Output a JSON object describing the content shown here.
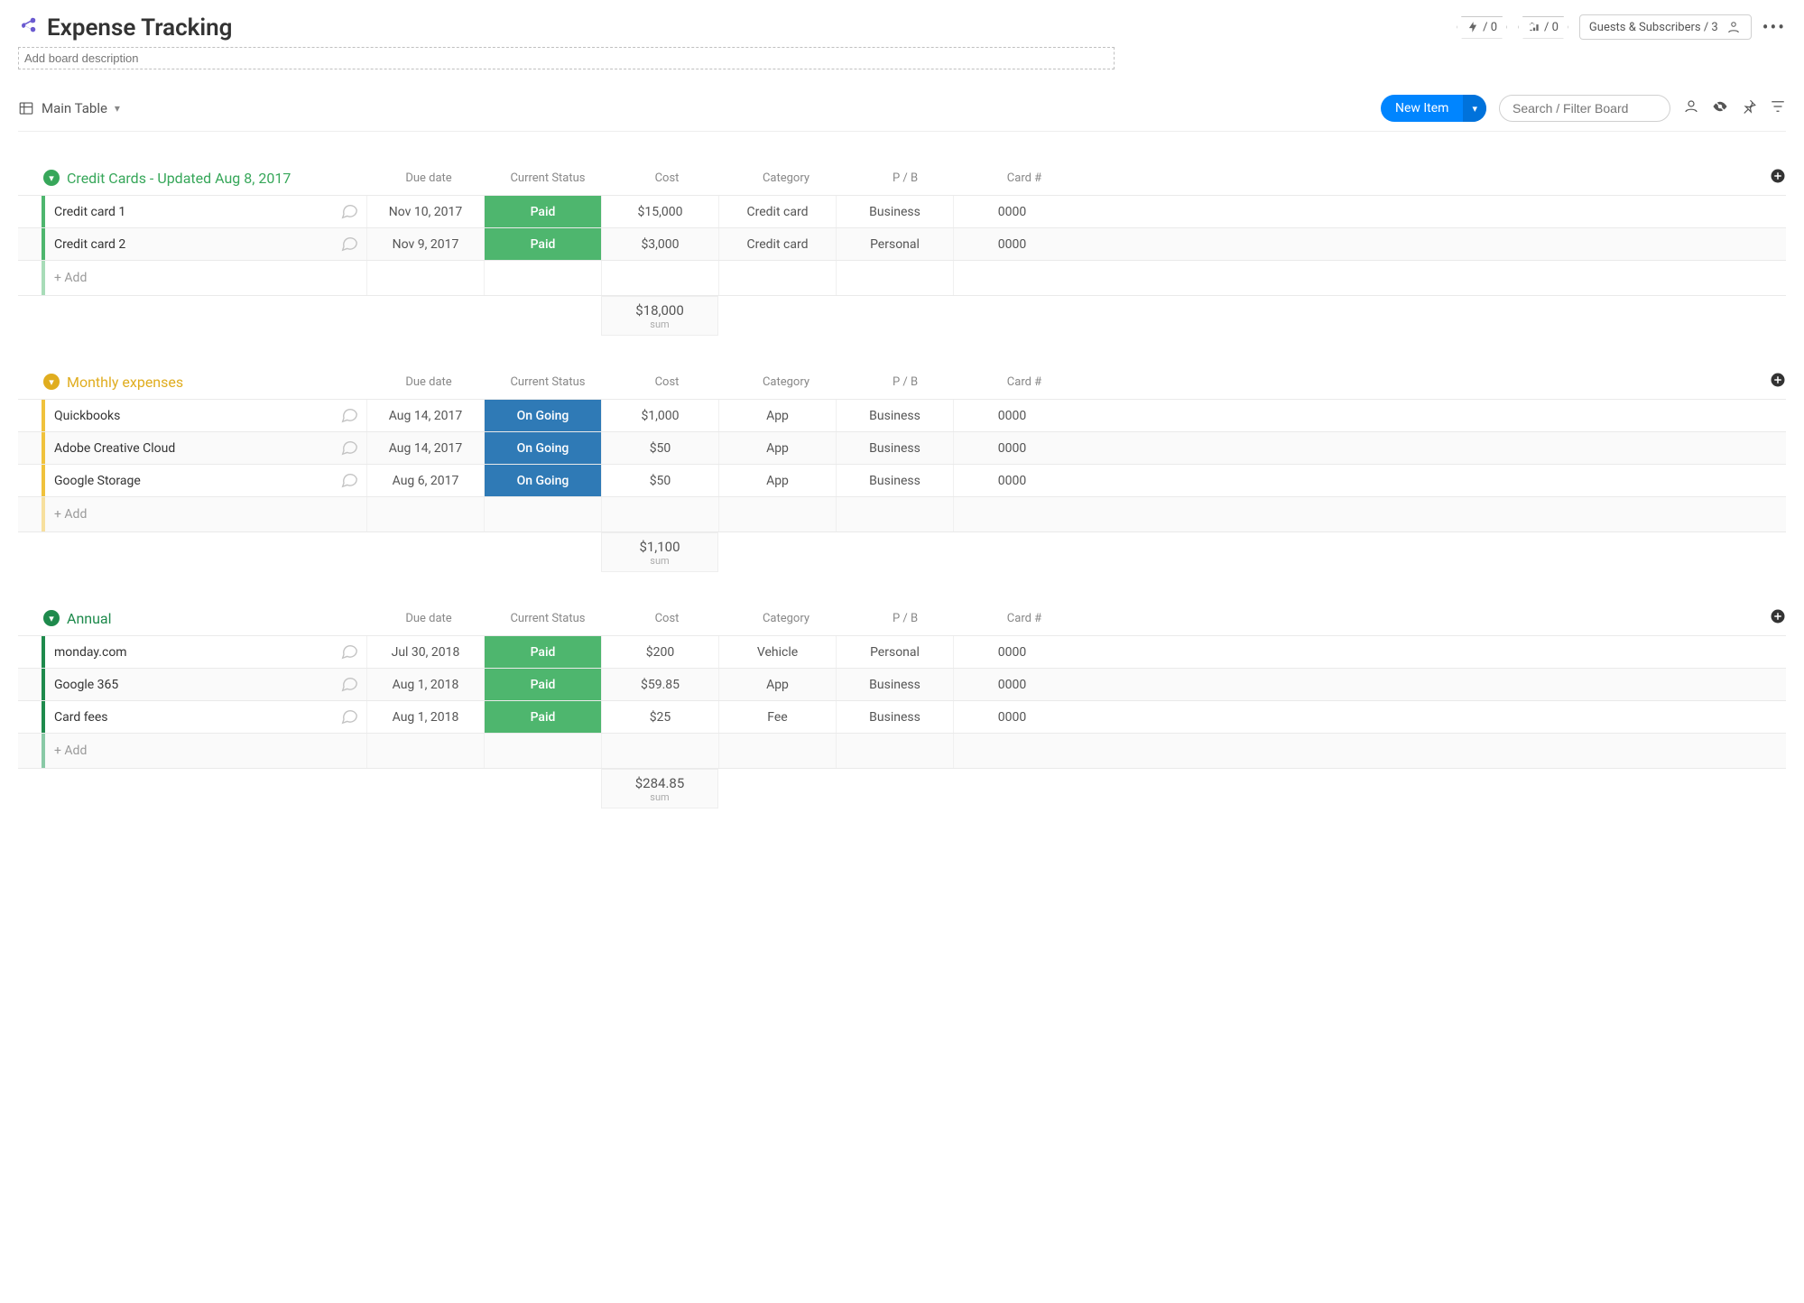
{
  "header": {
    "title": "Expense Tracking",
    "description_placeholder": "Add board description",
    "badge_integrations": "/ 0",
    "badge_automations": "/ 0",
    "guests_label": "Guests & Subscribers / 3"
  },
  "toolbar": {
    "view_label": "Main Table",
    "new_item_label": "New Item",
    "search_placeholder": "Search / Filter Board"
  },
  "columns": {
    "due_date": "Due date",
    "status": "Current Status",
    "cost": "Cost",
    "category": "Category",
    "pb": "P / B",
    "card": "Card #"
  },
  "add_row_label": "+ Add",
  "sum_label": "sum",
  "groups": [
    {
      "title": "Credit Cards - Updated Aug 8, 2017",
      "sum": "$18,000",
      "rows": [
        {
          "name": "Credit card 1",
          "due": "Nov 10, 2017",
          "status": "Paid",
          "status_class": "status-paid",
          "cost": "$15,000",
          "category": "Credit card",
          "pb": "Business",
          "card": "0000"
        },
        {
          "name": "Credit card 2",
          "due": "Nov 9, 2017",
          "status": "Paid",
          "status_class": "status-paid",
          "cost": "$3,000",
          "category": "Credit card",
          "pb": "Personal",
          "card": "0000"
        }
      ]
    },
    {
      "title": "Monthly expenses",
      "sum": "$1,100",
      "rows": [
        {
          "name": "Quickbooks",
          "due": "Aug 14, 2017",
          "status": "On Going",
          "status_class": "status-ongoing",
          "cost": "$1,000",
          "category": "App",
          "pb": "Business",
          "card": "0000"
        },
        {
          "name": "Adobe Creative Cloud",
          "due": "Aug 14, 2017",
          "status": "On Going",
          "status_class": "status-ongoing",
          "cost": "$50",
          "category": "App",
          "pb": "Business",
          "card": "0000"
        },
        {
          "name": "Google Storage",
          "due": "Aug 6, 2017",
          "status": "On Going",
          "status_class": "status-ongoing",
          "cost": "$50",
          "category": "App",
          "pb": "Business",
          "card": "0000"
        }
      ]
    },
    {
      "title": "Annual",
      "sum": "$284.85",
      "rows": [
        {
          "name": "monday.com",
          "due": "Jul 30, 2018",
          "status": "Paid",
          "status_class": "status-paid",
          "cost": "$200",
          "category": "Vehicle",
          "pb": "Personal",
          "card": "0000"
        },
        {
          "name": "Google 365",
          "due": "Aug 1, 2018",
          "status": "Paid",
          "status_class": "status-paid",
          "cost": "$59.85",
          "category": "App",
          "pb": "Business",
          "card": "0000"
        },
        {
          "name": "Card fees",
          "due": "Aug 1, 2018",
          "status": "Paid",
          "status_class": "status-paid",
          "cost": "$25",
          "category": "Fee",
          "pb": "Business",
          "card": "0000"
        }
      ]
    }
  ]
}
